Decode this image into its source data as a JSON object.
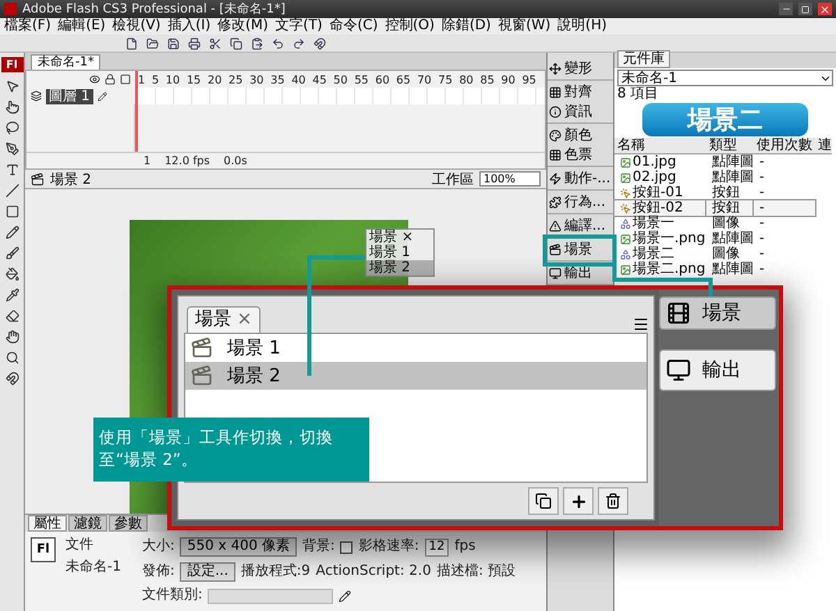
{
  "window": {
    "title": "Adobe Flash CS3 Professional - [未命名-1*]"
  },
  "menu": [
    "檔案(F)",
    "編輯(E)",
    "檢視(V)",
    "插入(I)",
    "修改(M)",
    "文字(T)",
    "命令(C)",
    "控制(O)",
    "除錯(D)",
    "視窗(W)",
    "說明(H)"
  ],
  "logo": "Fl",
  "document_tabs": [
    {
      "label": "未命名-1*",
      "selected": true
    }
  ],
  "timeline": {
    "frame_numbers": [
      "1",
      "5",
      "10",
      "15",
      "20",
      "25",
      "30",
      "35",
      "40",
      "45",
      "50",
      "55",
      "60",
      "65",
      "70",
      "75",
      "80",
      "85",
      "90",
      "95"
    ],
    "layers": [
      {
        "name": "圖層 1",
        "selected": true
      }
    ],
    "current_frame": "1",
    "frame_rate": "12.0 fps",
    "elapsed": "0.0s"
  },
  "scene_bar": {
    "scene": "場景 2",
    "workspace": "工作區",
    "zoom": "100%"
  },
  "mini_scene_panel": {
    "tab": "場景",
    "close": "×",
    "scenes": [
      {
        "name": "場景 1",
        "selected": false
      },
      {
        "name": "場景 2",
        "selected": true
      }
    ]
  },
  "properties": {
    "tabs": [
      {
        "label": "屬性",
        "selected": true
      },
      {
        "label": "濾鏡",
        "selected": false
      },
      {
        "label": "參數",
        "selected": false
      }
    ],
    "document_icon": "Fl",
    "doc_type": "文件",
    "doc_name": "未命名-1",
    "size_label": "大小:",
    "size_value": "550 x 400 像素",
    "background_label": "背景:",
    "frame_rate_label": "影格速率:",
    "frame_rate": "12",
    "fps_unit": "fps",
    "publish_label": "發佈:",
    "settings_button": "設定...",
    "player": "播放程式:9",
    "actionscript": "ActionScript: 2.0",
    "profile": "描述檔: 預設",
    "doc_class_label": "文件類別:"
  },
  "dock": [
    [
      {
        "label": "變形"
      }
    ],
    [
      {
        "label": "對齊"
      },
      {
        "label": "資訊"
      }
    ],
    [
      {
        "label": "顏色"
      },
      {
        "label": "色票"
      }
    ],
    [
      {
        "label": "動作-..."
      }
    ],
    [
      {
        "label": "行為..."
      }
    ],
    [
      {
        "label": "編譯..."
      }
    ],
    [
      {
        "label": "場景"
      }
    ],
    [
      {
        "label": "輸出"
      }
    ]
  ],
  "library": {
    "tab": "元件庫",
    "document": "未命名-1",
    "count": "8 項目",
    "preview_text": "場景二",
    "columns": [
      "名稱",
      "類型",
      "使用次數",
      "連"
    ],
    "rows": [
      {
        "name": "01.jpg",
        "type": "點陣圖",
        "uses": "-",
        "kind": "bitmap",
        "selected": false
      },
      {
        "name": "02.jpg",
        "type": "點陣圖",
        "uses": "-",
        "kind": "bitmap",
        "selected": false
      },
      {
        "name": "按鈕-01",
        "type": "按鈕",
        "uses": "-",
        "kind": "button",
        "selected": false
      },
      {
        "name": "按鈕-02",
        "type": "按鈕",
        "uses": "-",
        "kind": "button",
        "selected": true
      },
      {
        "name": "場景一",
        "type": "圖像",
        "uses": "-",
        "kind": "graphic",
        "selected": false
      },
      {
        "name": "場景一.png",
        "type": "點陣圖",
        "uses": "-",
        "kind": "bitmap",
        "selected": false
      },
      {
        "name": "場景二",
        "type": "圖像",
        "uses": "-",
        "kind": "graphic",
        "selected": false
      },
      {
        "name": "場景二.png",
        "type": "點陣圖",
        "uses": "-",
        "kind": "bitmap",
        "selected": false
      }
    ]
  },
  "zoom_panel": {
    "tab": "場景",
    "close": "×",
    "scenes": [
      {
        "name": "場景 1",
        "selected": false
      },
      {
        "name": "場景 2",
        "selected": true
      }
    ],
    "side_buttons": [
      {
        "label": "場景",
        "kind": "scene",
        "selected": true
      },
      {
        "label": "輸出",
        "kind": "output",
        "selected": false
      }
    ]
  },
  "callout": "使用「場景」工具作切換，切換至“場景 2”。"
}
